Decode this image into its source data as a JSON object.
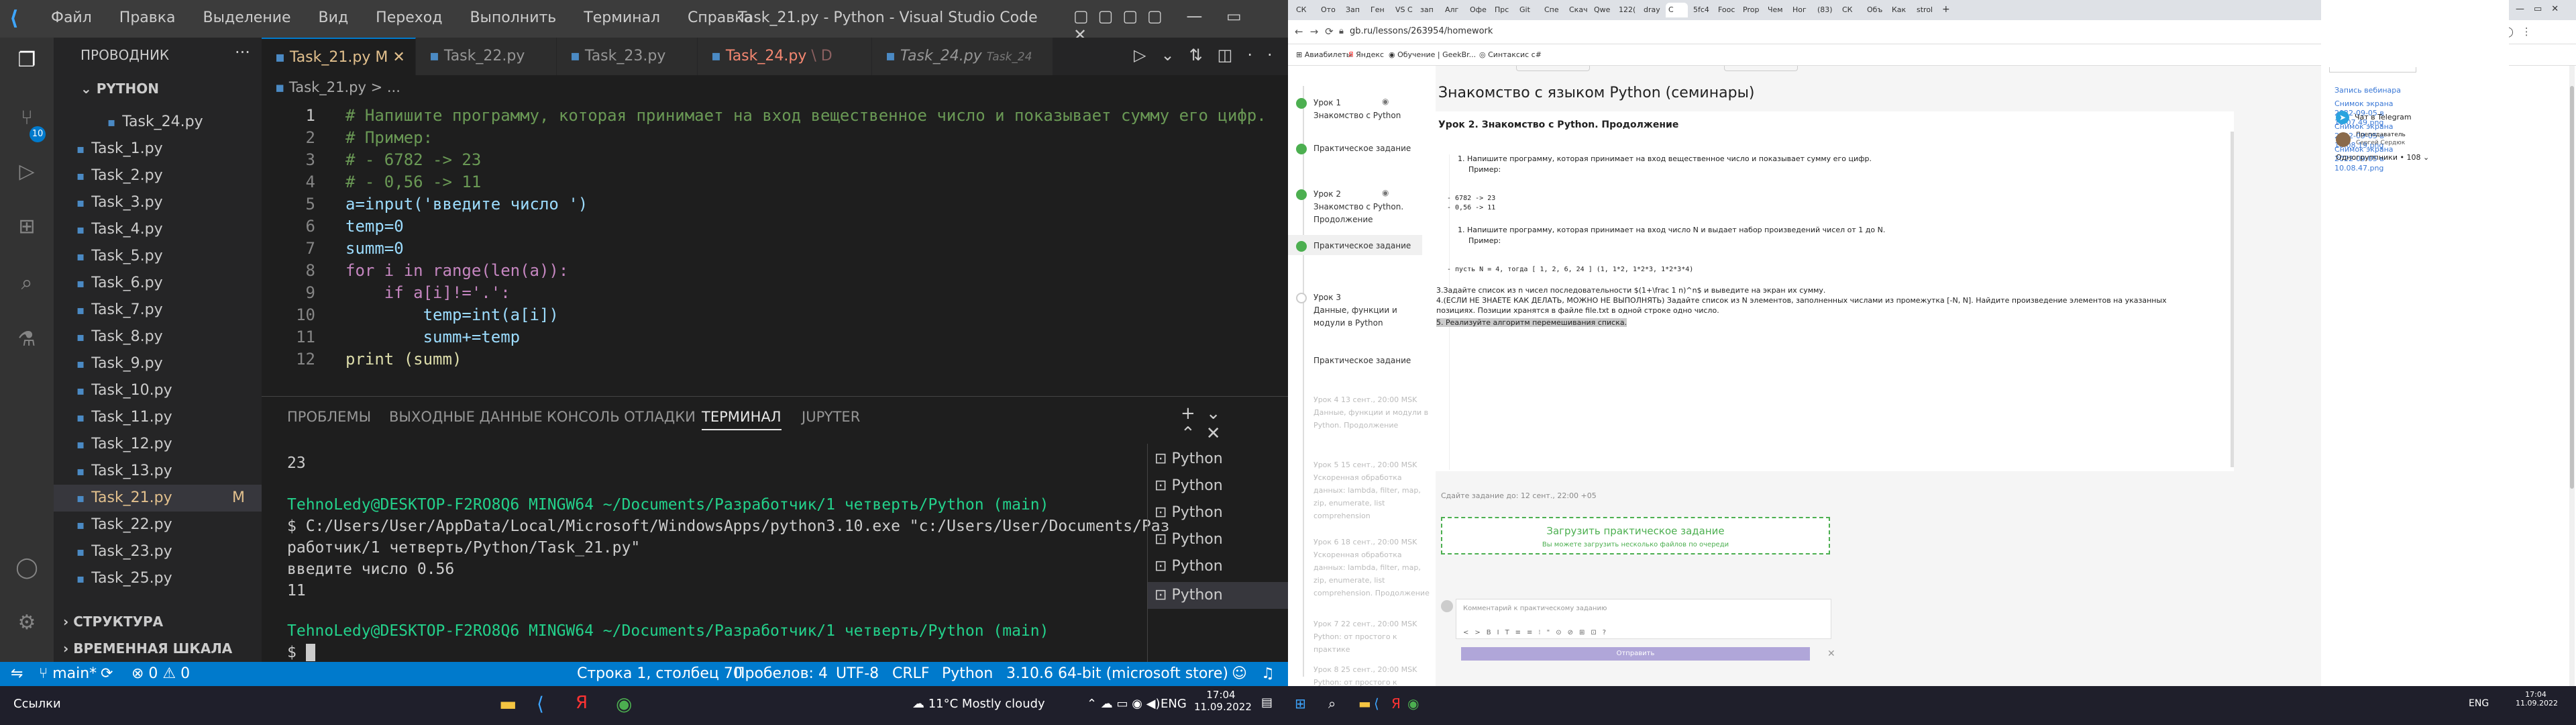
{
  "vscode": {
    "menu": [
      "Файл",
      "Правка",
      "Выделение",
      "Вид",
      "Переход",
      "Выполнить",
      "Терминал",
      "Справка"
    ],
    "window_title": "Task_21.py - Python - Visual Studio Code",
    "explorer_title": "ПРОВОДНИК",
    "folder_name": "PYTHON",
    "files": [
      "Task_24.py",
      "Task_1.py",
      "Task_2.py",
      "Task_3.py",
      "Task_4.py",
      "Task_5.py",
      "Task_6.py",
      "Task_7.py",
      "Task_8.py",
      "Task_9.py",
      "Task_10.py",
      "Task_11.py",
      "Task_12.py",
      "Task_13.py",
      "Task_21.py",
      "Task_22.py",
      "Task_23.py",
      "Task_25.py"
    ],
    "active_file_badge": "M",
    "outline_label": "СТРУКТУРА",
    "timeline_label": "ВРЕМЕННАЯ ШКАЛА",
    "tabs": [
      {
        "name": "Task_21.py",
        "badge": "M"
      },
      {
        "name": "Task_22.py",
        "badge": ""
      },
      {
        "name": "Task_23.py",
        "badge": ""
      },
      {
        "name": "Task_24.py",
        "badge": "\\ D"
      },
      {
        "name": "Task_24.py",
        "badge": "Task_24"
      }
    ],
    "breadcrumb": "Task_21.py > ...",
    "code_lines": [
      "# Напишите программу, которая принимает на вход вещественное число и показывает сумму его цифр.",
      "# Пример:",
      "# - 6782 -> 23",
      "# - 0,56 -> 11",
      "a=input('введите число ')",
      "temp=0",
      "summ=0",
      "for i in range(len(a)):",
      "    if a[i]!='.':",
      "        temp=int(a[i])",
      "        summ+=temp",
      "print (summ)"
    ],
    "panel_tabs": [
      "ПРОБЛЕМЫ",
      "ВЫХОДНЫЕ ДАННЫЕ",
      "КОНСОЛЬ ОТЛАДКИ",
      "ТЕРМИНАЛ",
      "JUPYTER"
    ],
    "terminal_lines": [
      "23",
      "",
      "",
      "TehnoLedy@DESKTOP-F2RO8Q6 MINGW64 ~/Documents/Разработчик/1 четверть/Python (main)",
      "$ C:/Users/User/AppData/Local/Microsoft/WindowsApps/python3.10.exe \"c:/Users/User/Documents/Раз",
      "работчик/1 четверть/Python/Task_21.py\"",
      "введите число 0.56",
      "11",
      "",
      "TehnoLedy@DESKTOP-F2RO8Q6 MINGW64 ~/Documents/Разработчик/1 четверть/Python (main)",
      "$ "
    ],
    "terminal_sessions": [
      "Python",
      "Python",
      "Python",
      "Python",
      "Python",
      "Python"
    ],
    "status": {
      "branch": "main*",
      "errors": "⊗ 0 ⚠ 0",
      "position": "Строка 1, столбец 70",
      "spaces": "Пробелов: 4",
      "encoding": "UTF-8",
      "eol": "CRLF",
      "language": "Python",
      "interpreter": "3.10.6 64-bit (microsoft store)"
    },
    "taskbar": {
      "links": "Ссылки",
      "weather": "11°C Mostly cloudy",
      "lang": "ENG",
      "time": "17:04",
      "date": "11.09.2022"
    }
  },
  "browser": {
    "tab_labels": [
      "СК",
      "Ото",
      "Зап",
      "Ген",
      "VS С",
      "зап",
      "Алг",
      "Офе",
      "Прс",
      "Git",
      "Спе",
      "Скач",
      "Qwe",
      "122(",
      "dray",
      "С",
      "5fc4",
      "Fooc",
      "Prop",
      "Чем",
      "Ног",
      "(83)",
      "СК",
      "Объ",
      "Как",
      "strol"
    ],
    "url": "gb.ru/lessons/263954/homework",
    "bookmarks": [
      "Авиабилеты",
      "Яндекс",
      "Обучение | GeekBr...",
      "Синтаксис c#"
    ],
    "lessons": [
      {
        "title": "Урок 1",
        "sub": "Знакомство с Python",
        "active": true
      },
      {
        "title": "Практическое задание",
        "sub": "",
        "active": true
      },
      {
        "title": "Урок 2",
        "sub": "Знакомство с Python. Продолжение",
        "active": true
      },
      {
        "title": "Практическое задание",
        "sub": "",
        "active": true
      },
      {
        "title": "Урок 3",
        "sub": "Данные, функции и модули в Python",
        "active": false
      },
      {
        "title": "Практическое задание",
        "sub": "",
        "active": false
      },
      {
        "title": "Урок 4 13 сент., 20:00 МSK",
        "sub": "Данные, функции и модули в Python. Продолжение",
        "active": false
      },
      {
        "title": "Урок 5 15 сент., 20:00 MSK",
        "sub": "Ускоренная обработка данных: lambda, filter, map, zip, enumerate, list comprehension",
        "active": false
      },
      {
        "title": "Урок 6 18 сент., 20:00 MSK",
        "sub": "Ускоренная обработка данных: lambda, filter, map, zip, enumerate, list comprehension. Продолжение",
        "active": false
      },
      {
        "title": "Урок 7 22 сент., 20:00 MSK",
        "sub": "Python: от простого к практике",
        "active": false
      },
      {
        "title": "Урок 8 25 сент., 20:00 MSK",
        "sub": "Python: от простого к практике",
        "active": false
      }
    ],
    "page_title": "Знакомство с языком Python (семинары)",
    "lesson_heading": "Урок 2. Знакомство с Python. Продолжение",
    "task1": "Напишите программу, которая принимает на вход вещественное число и показывает сумму его цифр.",
    "example_label": "Пример:",
    "ex1": "- 6782 -> 23",
    "ex2": "- 0,56 -> 11",
    "task2": "Напишите программу, которая принимает на вход число N и выдает набор произведений чисел от 1 до N.",
    "ex3": "- пусть N = 4, тогда [ 1, 2, 6, 24 ] (1, 1*2, 1*2*3, 1*2*3*4)",
    "task3": "3.Задайте список из n чисел последовательности $(1+\\frac 1 n)^n$ и выведите на экран их сумму.",
    "task4": "4.(ЕСЛИ НЕ ЗНАЕТЕ КАК ДЕЛАТЬ, МОЖНО НЕ ВЫПОЛНЯТЬ) Задайте список из N элементов, заполненных числами из промежутка [-N, N]. Найдите произведение элементов на указанных позициях. Позиции хранятся в файле file.txt в одной строке одно число.",
    "task5": "5. Реализуйте алгоритм перемешивания списка.",
    "deadline": "Сдайте задание до: 12 сент., 22:00 +05",
    "upload_title": "Загрузить практическое задание",
    "upload_sub": "Вы можете загрузить несколько файлов по очереди",
    "comment_placeholder": "Комментарий к практическому заданию",
    "send_label": "Отправить",
    "right_links": [
      "Запись вебинара",
      "Снимок экрана 2022-09-05 в 10.07.49.png",
      "Снимок экрана 2022-09-05 в 10.08.19.png",
      "Снимок экрана 2022-09-05 в 10.08.47.png"
    ],
    "telegram": "Чат в Telegram",
    "teacher_role": "Преподаватель",
    "teacher_name": "Сергей Сердюк",
    "classmates": "Одногруппники • 108",
    "taskbar": {
      "lang": "ENG",
      "time": "17:04",
      "date": "11.09.2022"
    }
  }
}
